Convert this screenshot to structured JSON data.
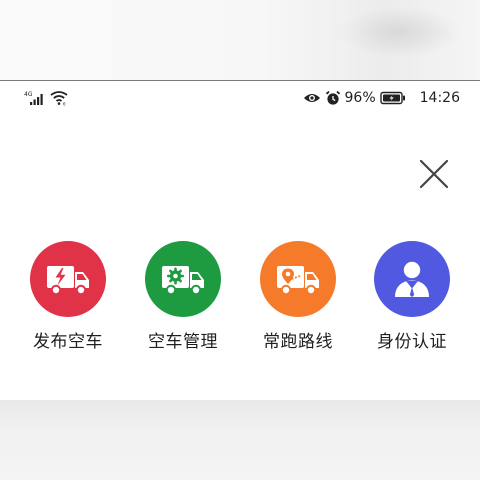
{
  "status_bar": {
    "network": "4G",
    "battery": "96%",
    "time": "14:26",
    "icons": [
      "signal-icon",
      "wifi-icon",
      "eye-icon",
      "alarm-icon",
      "battery-icon"
    ]
  },
  "actions": [
    {
      "label": "发布空车",
      "icon": "truck-bolt-icon",
      "color": "#e03348"
    },
    {
      "label": "空车管理",
      "icon": "truck-gear-icon",
      "color": "#1e9a41"
    },
    {
      "label": "常跑路线",
      "icon": "truck-pin-icon",
      "color": "#f57a2a"
    },
    {
      "label": "身份认证",
      "icon": "user-badge-icon",
      "color": "#5059e0"
    }
  ],
  "close_icon": "close-icon"
}
